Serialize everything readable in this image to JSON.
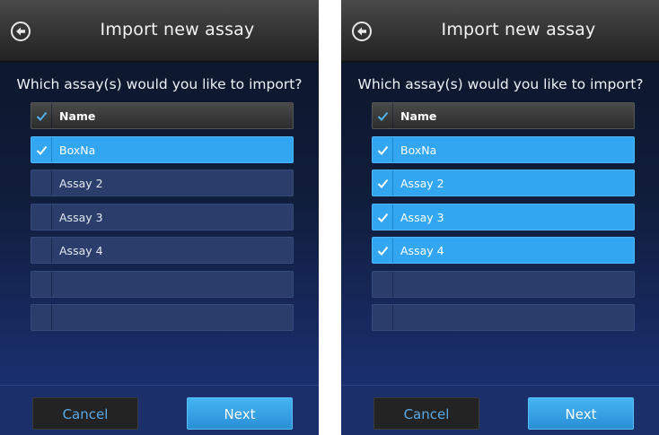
{
  "screens": [
    {
      "title": "Import new assay",
      "prompt": "Which assay(s) would you like to import?",
      "column_header": "Name",
      "rows": [
        {
          "label": "BoxNa",
          "selected": true
        },
        {
          "label": "Assay 2",
          "selected": false
        },
        {
          "label": "Assay 3",
          "selected": false
        },
        {
          "label": "Assay 4",
          "selected": false
        },
        {
          "label": "",
          "selected": false
        },
        {
          "label": "",
          "selected": false
        }
      ],
      "cancel_label": "Cancel",
      "next_label": "Next"
    },
    {
      "title": "Import new assay",
      "prompt": "Which assay(s) would you like to import?",
      "column_header": "Name",
      "rows": [
        {
          "label": "BoxNa",
          "selected": true
        },
        {
          "label": "Assay 2",
          "selected": true
        },
        {
          "label": "Assay 3",
          "selected": true
        },
        {
          "label": "Assay 4",
          "selected": true
        },
        {
          "label": "",
          "selected": false
        },
        {
          "label": "",
          "selected": false
        }
      ],
      "cancel_label": "Cancel",
      "next_label": "Next"
    }
  ],
  "icons": {
    "back": "back-arrow-icon",
    "check": "checkmark-icon"
  },
  "colors": {
    "selected_row": "#33a6f2",
    "unselected_row": "#2b3e6b",
    "check_on_dark": "#4fb3f0",
    "check_on_selected": "#ffffff",
    "cancel_text": "#5aa9e6",
    "next_button": "#2a8fd6"
  }
}
